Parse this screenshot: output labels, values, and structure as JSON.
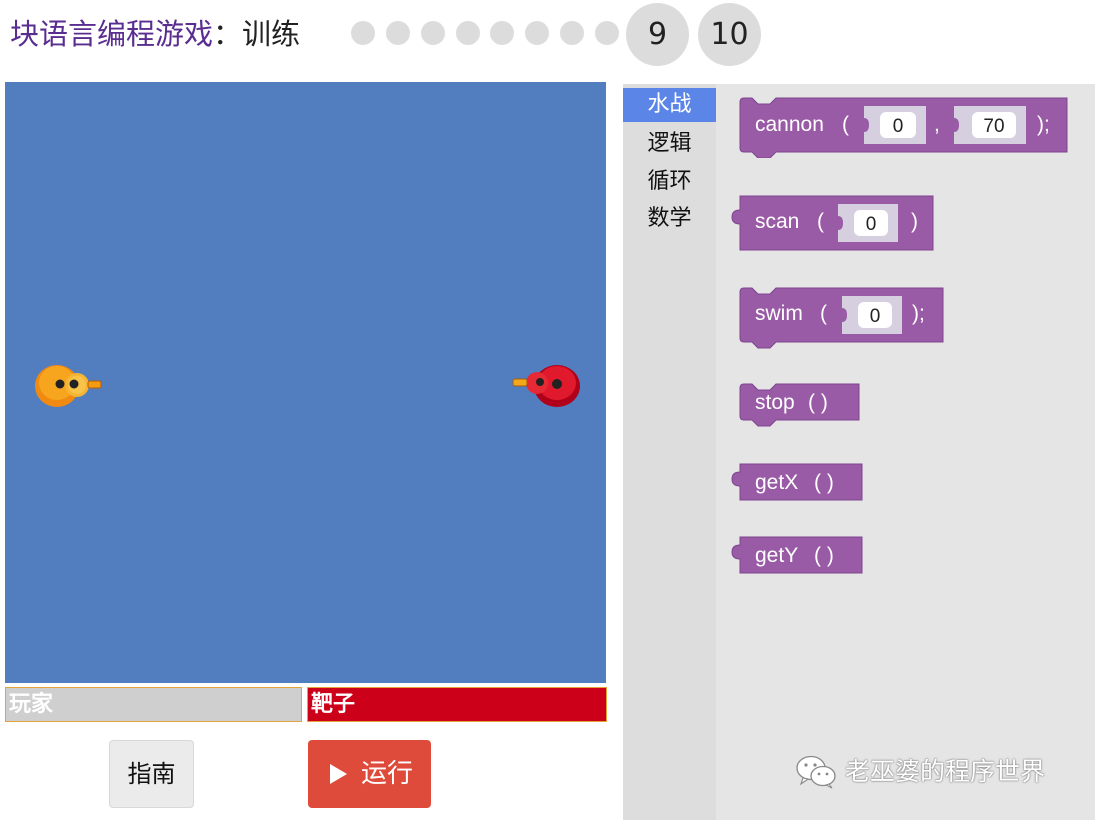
{
  "header": {
    "game_name": "块语言编程游戏",
    "separator": "：",
    "mode": "训练",
    "levels": [
      "",
      "",
      "",
      "",
      "",
      "",
      "",
      "",
      "9",
      "10"
    ]
  },
  "stage": {
    "background": "#527ec0",
    "player_icon": "yellow-duck-icon",
    "target_icon": "red-duck-icon"
  },
  "health": {
    "player_label": "玩家",
    "target_label": "靶子"
  },
  "buttons": {
    "guide": "指南",
    "run": "运行"
  },
  "toolbox": {
    "categories": [
      "水战",
      "逻辑",
      "循环",
      "数学"
    ],
    "selected": "水战"
  },
  "blocks": {
    "cannon": {
      "name": "cannon",
      "open": "(",
      "arg1": "0",
      "comma": ",",
      "arg2": "70",
      "close": ");"
    },
    "scan": {
      "name": "scan",
      "open": "(",
      "arg1": "0",
      "close": ")"
    },
    "swim": {
      "name": "swim",
      "open": "(",
      "arg1": "0",
      "close": ");"
    },
    "stop": {
      "name": "stop",
      "parens": "(  )"
    },
    "getX": {
      "name": "getX",
      "parens": "(  )"
    },
    "getY": {
      "name": "getY",
      "parens": "(  )"
    }
  },
  "colors": {
    "block": "#9a5ba6",
    "block_dark": "#7d4590",
    "input_slot": "#d6cfe0",
    "run_button": "#df4b3b",
    "selected_category": "#5b86e8"
  },
  "watermark": "老巫婆的程序世界"
}
